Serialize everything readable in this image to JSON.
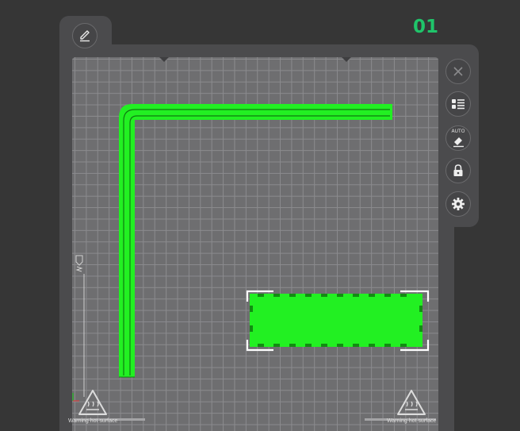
{
  "plate": {
    "number": "01"
  },
  "toolbar": {
    "close": {
      "icon": "close-icon"
    },
    "objects_list": {
      "icon": "list-icon"
    },
    "auto_orient": {
      "icon": "auto-eraser-icon",
      "label": "AUTO"
    },
    "lock": {
      "icon": "lock-icon"
    },
    "settings": {
      "icon": "gear-icon"
    }
  },
  "edit": {
    "icon": "pencil-icon"
  },
  "warnings": {
    "left": {
      "text": "Warning hot surface",
      "icon": "hot-surface-warning-icon"
    },
    "right": {
      "text": "Warning hot surface",
      "icon": "hot-surface-warning-icon"
    }
  },
  "colors": {
    "accent": "#1fc46a",
    "model": "#22f022",
    "bed": "#6e6e70",
    "panel": "#4b4b4d",
    "background": "#363636"
  }
}
